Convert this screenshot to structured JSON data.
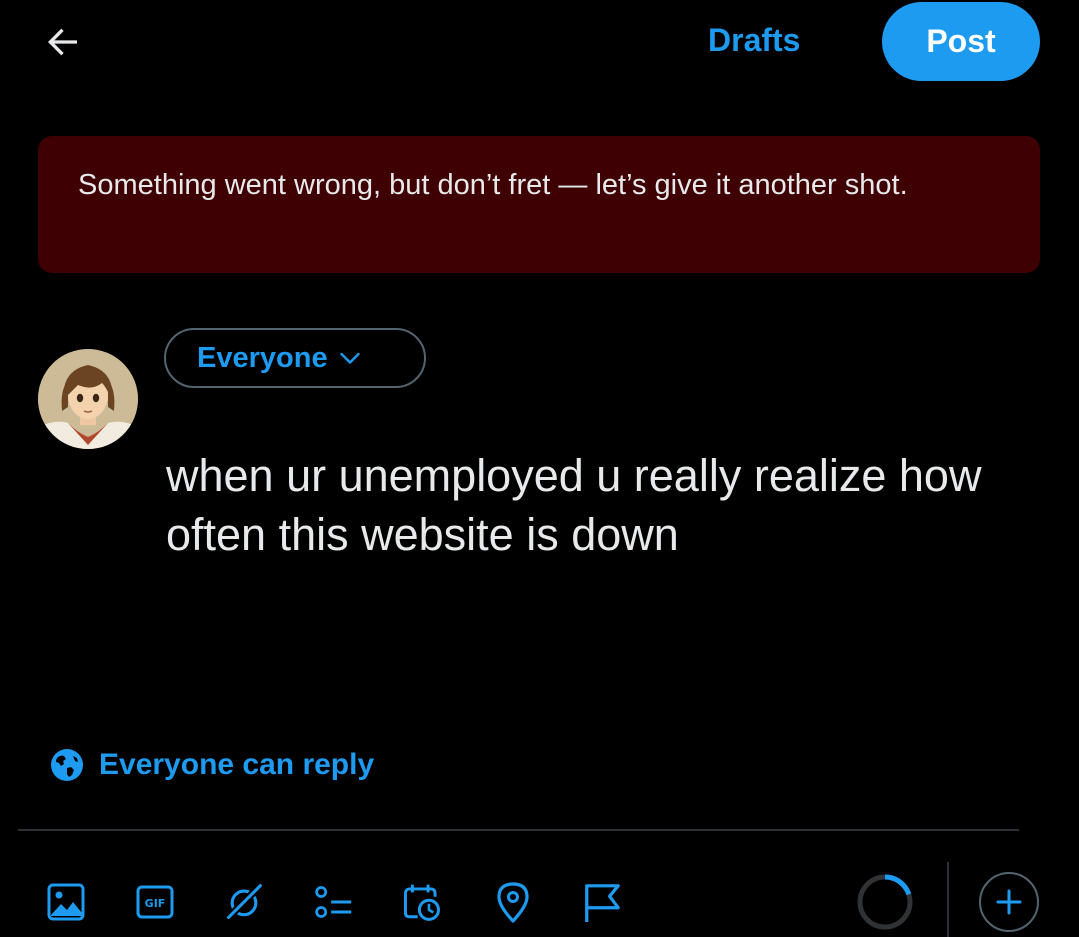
{
  "header": {
    "drafts_label": "Drafts",
    "post_label": "Post"
  },
  "error": {
    "message": "Something went wrong, but don’t fret — let’s give it another shot."
  },
  "composer": {
    "audience_label": "Everyone",
    "text": "when ur unemployed u really realize how often this website is down",
    "reply_setting_label": "Everyone can reply"
  },
  "toolbar": {
    "icons": [
      "media-icon",
      "gif-icon",
      "grok-icon",
      "poll-icon",
      "schedule-icon",
      "location-icon",
      "flag-icon"
    ],
    "progress": 0.2
  },
  "colors": {
    "accent": "#1d9bf0",
    "error_background": "#3f0004",
    "text": "#e7e9ea",
    "border": "#536471"
  }
}
